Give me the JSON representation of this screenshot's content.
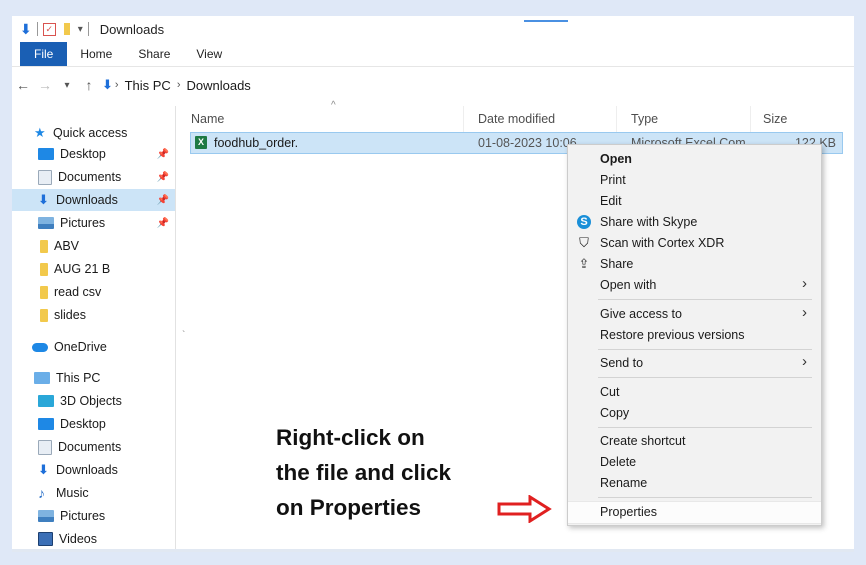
{
  "window": {
    "title": "Downloads"
  },
  "ribbon": {
    "tabs": [
      "File",
      "Home",
      "Share",
      "View"
    ]
  },
  "address": {
    "crumbs": [
      "This PC",
      "Downloads"
    ]
  },
  "columns": {
    "name": "Name",
    "date": "Date modified",
    "type": "Type",
    "size": "Size"
  },
  "file": {
    "name": "foodhub_order.",
    "date": "01-08-2023 10:06",
    "type": "Microsoft Excel Com...",
    "size": "122 KB"
  },
  "nav": {
    "quick_access": "Quick access",
    "items_quick": [
      "Desktop",
      "Documents",
      "Downloads",
      "Pictures",
      "ABV",
      "AUG 21 B",
      "read csv",
      "slides"
    ],
    "onedrive": "OneDrive",
    "this_pc": "This PC",
    "items_pc": [
      "3D Objects",
      "Desktop",
      "Documents",
      "Downloads",
      "Music",
      "Pictures",
      "Videos"
    ]
  },
  "menu": {
    "open": "Open",
    "print": "Print",
    "edit": "Edit",
    "skype": "Share with Skype",
    "cortex": "Scan with Cortex XDR",
    "share": "Share",
    "open_with": "Open with",
    "give_access": "Give access to",
    "restore": "Restore previous versions",
    "send_to": "Send to",
    "cut": "Cut",
    "copy": "Copy",
    "create_shortcut": "Create shortcut",
    "delete": "Delete",
    "rename": "Rename",
    "properties": "Properties"
  },
  "annotation": {
    "line1": "Right-click on",
    "line2": "the file and click",
    "line3": "on Properties"
  },
  "colors": {
    "accent": "#1a5fb4",
    "selection": "#cce4f7",
    "arrow": "#e02020"
  }
}
